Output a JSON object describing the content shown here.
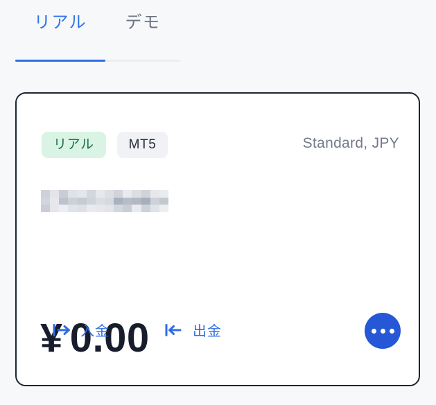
{
  "tabs": {
    "items": [
      {
        "label": "リアル",
        "active": true
      },
      {
        "label": "デモ",
        "active": false
      }
    ]
  },
  "account_card": {
    "badges": {
      "account_kind": "リアル",
      "platform": "MT5"
    },
    "account_type": "Standard, JPY",
    "account_id": {
      "label": "",
      "redacted": true
    },
    "balance": {
      "currency_symbol": "¥",
      "amount": "0.00"
    },
    "actions": [
      {
        "label": "入金",
        "icon": "arrow-right-to-bar-icon"
      },
      {
        "label": "出金",
        "icon": "arrow-left-to-bar-icon"
      }
    ],
    "more_button": {
      "icon": "ellipsis-icon"
    }
  },
  "colors": {
    "page_background": "#f7f8fa",
    "accent_blue": "#2f6ce5",
    "tab_active": "#3172ec",
    "tab_inactive": "#6b7280",
    "badge_real_bg": "#d9f4e4",
    "badge_real_text": "#1b6b4b",
    "badge_platform_bg": "#f1f2f5",
    "badge_platform_text": "#252b3b",
    "card_border": "#1d2435",
    "balance_text": "#171d2c",
    "muted_text": "#737b8a",
    "more_button_bg": "#2557d6"
  }
}
